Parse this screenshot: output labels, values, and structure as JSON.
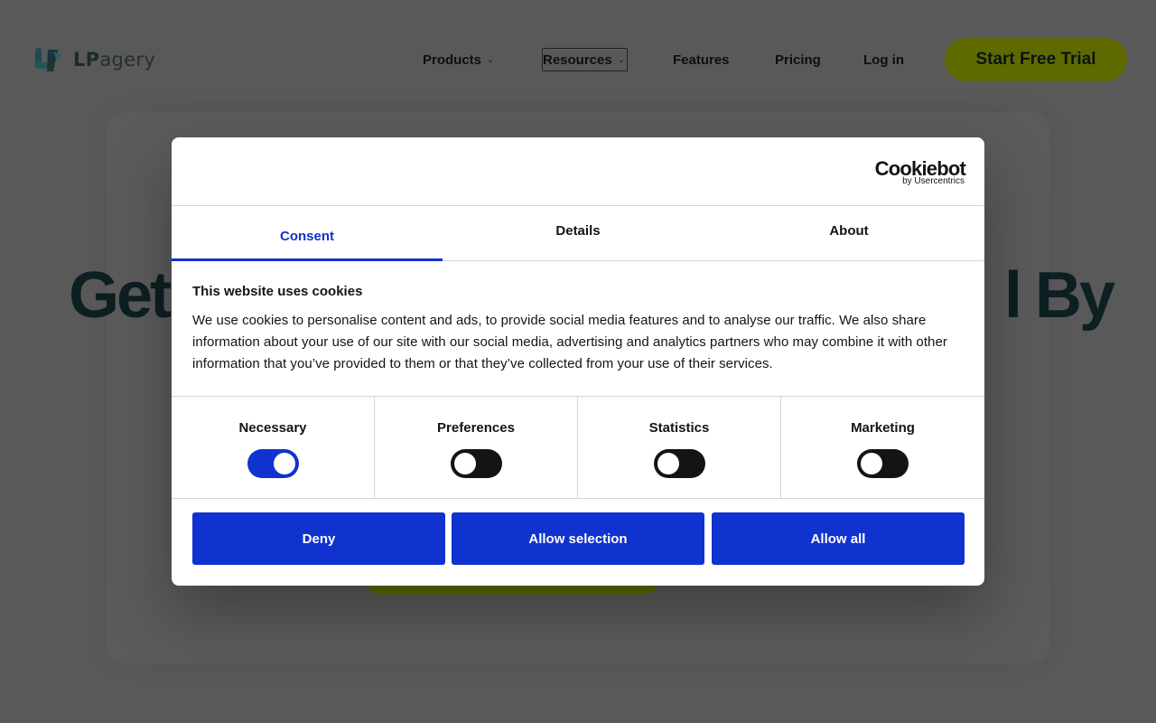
{
  "site": {
    "logo": {
      "lp": "LP",
      "rest": "agery"
    },
    "nav": {
      "products": "Products",
      "resources": "Resources",
      "features": "Features",
      "pricing": "Pricing",
      "login": "Log in",
      "cta": "Start Free Trial"
    },
    "hero": {
      "title_left": "Get",
      "title_right": "l By"
    },
    "colors": {
      "cta_bg": "#d4f000",
      "overlay": "rgba(0,0,0,0.65)"
    }
  },
  "cookie_dialog": {
    "brand": {
      "name": "Cookiebot",
      "sub": "by Usercentrics"
    },
    "tabs": [
      {
        "label": "Consent",
        "active": true
      },
      {
        "label": "Details",
        "active": false
      },
      {
        "label": "About",
        "active": false
      }
    ],
    "title": "This website uses cookies",
    "description": "We use cookies to personalise content and ads, to provide social media features and to analyse our traffic. We also share information about your use of our site with our social media, advertising and analytics partners who may combine it with other information that you’ve provided to them or that they’ve collected from your use of their services.",
    "categories": [
      {
        "label": "Necessary",
        "enabled": true
      },
      {
        "label": "Preferences",
        "enabled": false
      },
      {
        "label": "Statistics",
        "enabled": false
      },
      {
        "label": "Marketing",
        "enabled": false
      }
    ],
    "buttons": {
      "deny": "Deny",
      "allow_selection": "Allow selection",
      "allow_all": "Allow all"
    },
    "accent_color": "#1032cf"
  }
}
